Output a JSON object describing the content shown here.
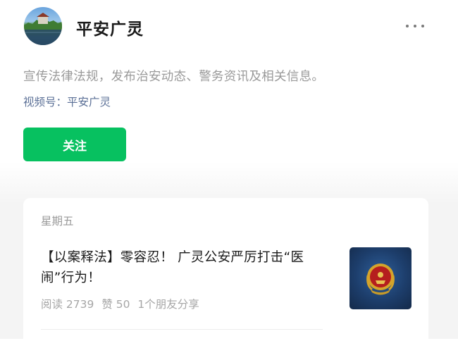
{
  "account": {
    "name": "平安广灵",
    "description": "宣传法律法规，发布治安动态、警务资讯及相关信息。",
    "channel_label": "视频号：平安广灵",
    "follow_label": "关注"
  },
  "menu": {
    "icon": "more-dots-icon"
  },
  "articles": [
    {
      "day": "星期五",
      "title": "【以案释法】零容忍！ 广灵公安严厉打击“医闹”行为！",
      "reads": "阅读 2739",
      "likes": "赞 50",
      "shares": "1个朋友分享",
      "thumbnail_icon": "police-emblem-icon"
    }
  ],
  "colors": {
    "follow_button": "#07c160",
    "channel_link": "#5a6f96",
    "secondary_text": "#9a9a9a"
  }
}
